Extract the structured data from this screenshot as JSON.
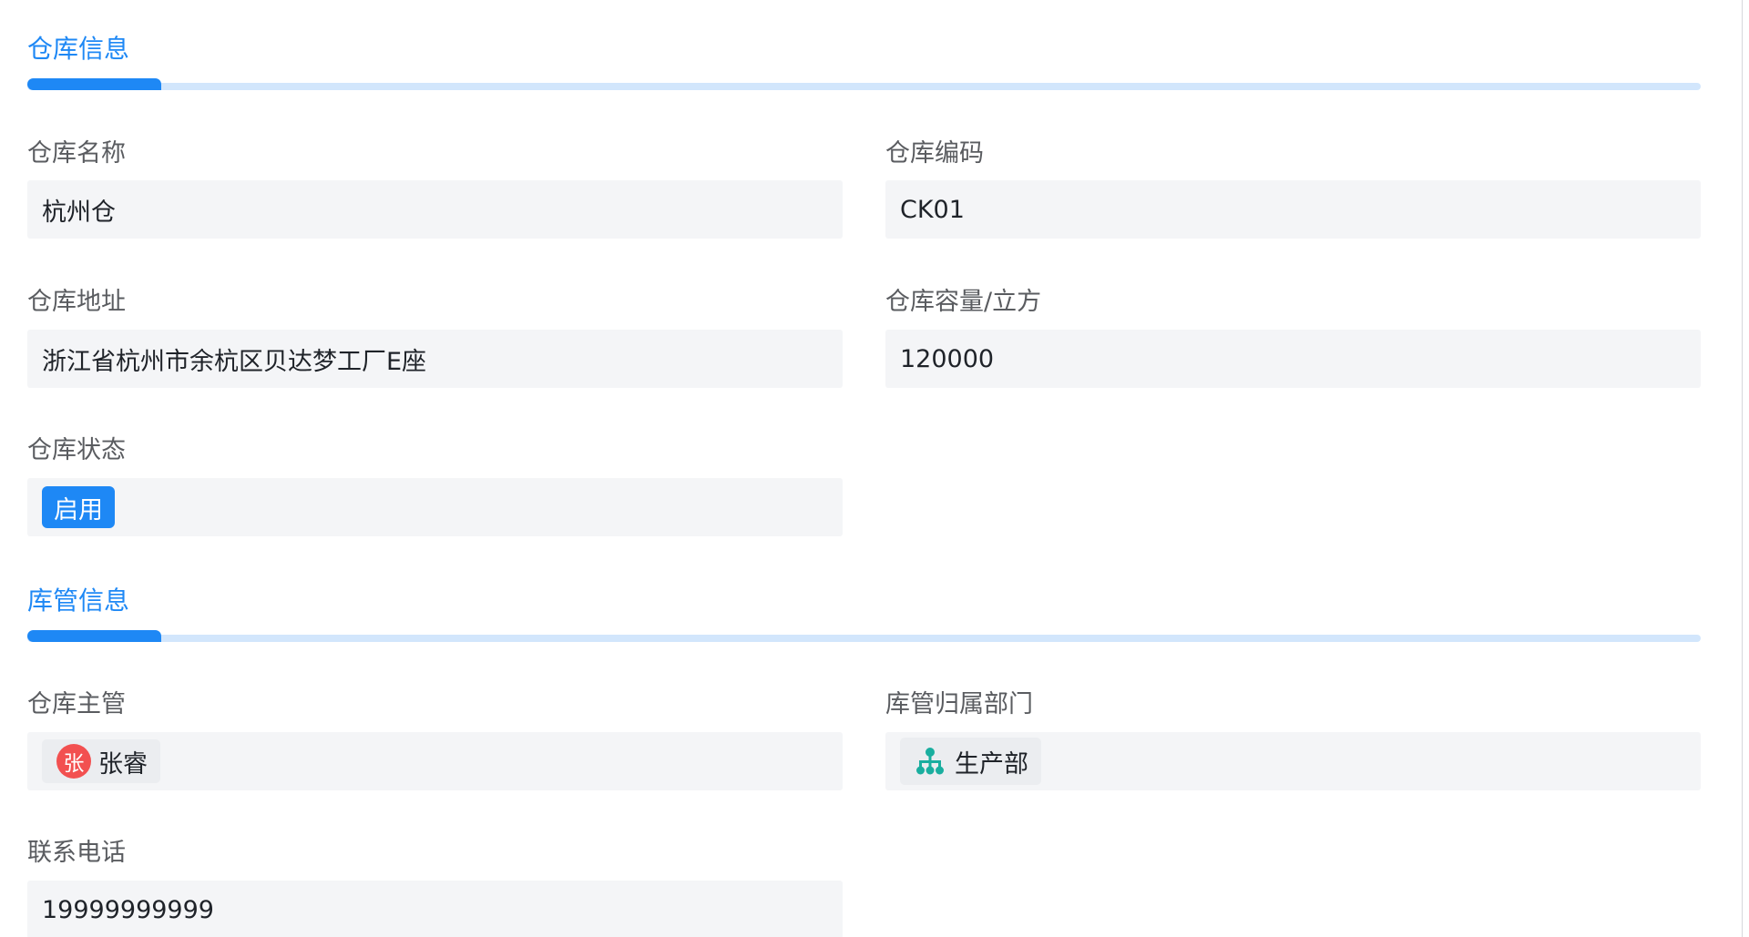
{
  "sections": {
    "warehouse_info": {
      "title": "仓库信息"
    },
    "keeper_info": {
      "title": "库管信息"
    }
  },
  "fields": {
    "warehouse_name": {
      "label": "仓库名称",
      "value": "杭州仓"
    },
    "warehouse_code": {
      "label": "仓库编码",
      "value": "CK01"
    },
    "warehouse_address": {
      "label": "仓库地址",
      "value": "浙江省杭州市余杭区贝达梦工厂E座"
    },
    "warehouse_capacity": {
      "label": "仓库容量/立方",
      "value": "120000"
    },
    "warehouse_status": {
      "label": "仓库状态",
      "value": "启用",
      "color": "#1e88f5"
    },
    "warehouse_manager": {
      "label": "仓库主管",
      "value": "张睿",
      "avatar_text": "张",
      "avatar_color": "#f25050"
    },
    "keeper_department": {
      "label": "库管归属部门",
      "value": "生产部",
      "icon": "org-chart-icon",
      "icon_color": "#1aae9f"
    },
    "contact_phone": {
      "label": "联系电话",
      "value": "19999999999"
    }
  },
  "theme": {
    "accent": "#1e88f5",
    "accent_light": "#d2e6fc",
    "field_bg": "#f4f5f7"
  }
}
